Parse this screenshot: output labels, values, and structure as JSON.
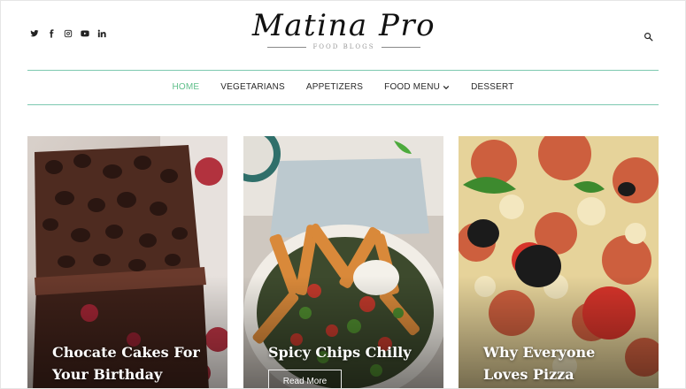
{
  "site": {
    "title": "Matina Pro",
    "tagline": "FOOD BLOGS"
  },
  "socials": [
    "twitter-icon",
    "facebook-icon",
    "instagram-icon",
    "youtube-icon",
    "linkedin-icon"
  ],
  "nav": {
    "items": [
      {
        "label": "HOME",
        "active": true
      },
      {
        "label": "VEGETARIANS"
      },
      {
        "label": "APPETIZERS"
      },
      {
        "label": "FOOD MENU",
        "has_dropdown": true
      },
      {
        "label": "DESSERT"
      }
    ]
  },
  "posts": [
    {
      "title_line1": "Chocate Cakes For",
      "title_line2": "Your Birthday"
    },
    {
      "title_line1": "Spicy Chips Chilly",
      "read_more": "Read More"
    },
    {
      "title_line1": "Why Everyone",
      "title_line2": "Loves Pizza"
    }
  ],
  "colors": {
    "accent": "#5fbf8a",
    "divider": "#7dc9b0",
    "text": "#2a2a2a"
  }
}
